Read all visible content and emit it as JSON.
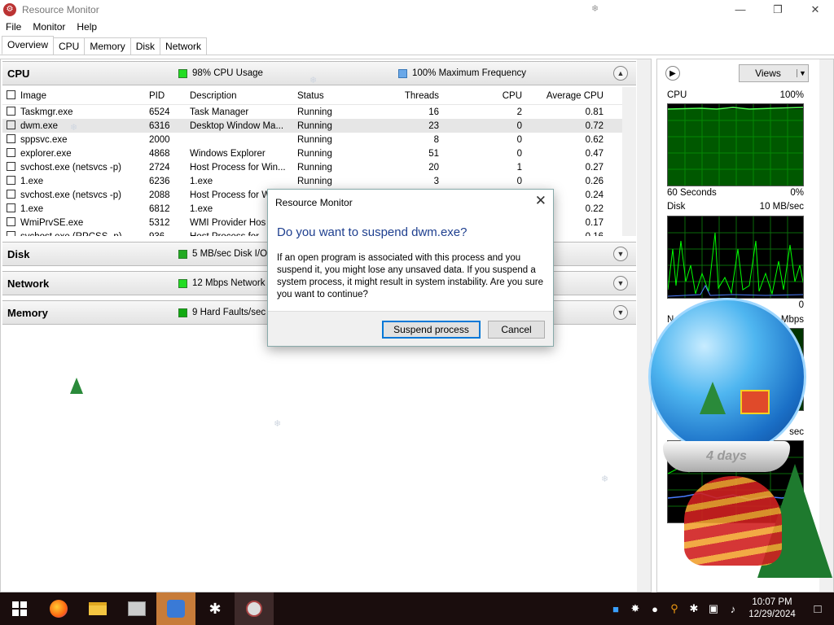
{
  "window": {
    "title": "Resource Monitor",
    "minimize_glyph": "—",
    "restore_glyph": "❐",
    "close_glyph": "✕"
  },
  "menu": [
    "File",
    "Monitor",
    "Help"
  ],
  "tabs": [
    "Overview",
    "CPU",
    "Memory",
    "Disk",
    "Network"
  ],
  "cpu_section": {
    "name": "CPU",
    "usage": "98% CPU Usage",
    "max_freq": "100% Maximum Frequency",
    "columns": [
      "Image",
      "PID",
      "Description",
      "Status",
      "Threads",
      "CPU",
      "Average CPU"
    ],
    "rows": [
      {
        "image": "Taskmgr.exe",
        "pid": "6524",
        "desc": "Task Manager",
        "status": "Running",
        "threads": "16",
        "cpu": "2",
        "avg": "0.81",
        "selected": false
      },
      {
        "image": "dwm.exe",
        "pid": "6316",
        "desc": "Desktop Window Ma...",
        "status": "Running",
        "threads": "23",
        "cpu": "0",
        "avg": "0.72",
        "selected": true
      },
      {
        "image": "sppsvc.exe",
        "pid": "2000",
        "desc": "",
        "status": "Running",
        "threads": "8",
        "cpu": "0",
        "avg": "0.62",
        "selected": false
      },
      {
        "image": "explorer.exe",
        "pid": "4868",
        "desc": "Windows Explorer",
        "status": "Running",
        "threads": "51",
        "cpu": "0",
        "avg": "0.47",
        "selected": false
      },
      {
        "image": "svchost.exe (netsvcs -p)",
        "pid": "2724",
        "desc": "Host Process for Win...",
        "status": "Running",
        "threads": "20",
        "cpu": "1",
        "avg": "0.27",
        "selected": false
      },
      {
        "image": "1.exe",
        "pid": "6236",
        "desc": "1.exe",
        "status": "Running",
        "threads": "3",
        "cpu": "0",
        "avg": "0.26",
        "selected": false
      },
      {
        "image": "svchost.exe (netsvcs -p)",
        "pid": "2088",
        "desc": "Host Process for W",
        "status": "",
        "threads": "",
        "cpu": "",
        "avg": "0.24",
        "selected": false
      },
      {
        "image": "1.exe",
        "pid": "6812",
        "desc": "1.exe",
        "status": "",
        "threads": "",
        "cpu": "",
        "avg": "0.22",
        "selected": false
      },
      {
        "image": "WmiPrvSE.exe",
        "pid": "5312",
        "desc": "WMI Provider Hos",
        "status": "",
        "threads": "",
        "cpu": "",
        "avg": "0.17",
        "selected": false
      },
      {
        "image": "svchost.exe (RPCSS -p)",
        "pid": "936",
        "desc": "Host Process for",
        "status": "",
        "threads": "",
        "cpu": "",
        "avg": "0.16",
        "selected": false
      }
    ]
  },
  "disk_section": {
    "name": "Disk",
    "stat": "5 MB/sec Disk I/O"
  },
  "network_section": {
    "name": "Network",
    "stat": "12 Mbps Network"
  },
  "memory_section": {
    "name": "Memory",
    "stat": "9 Hard Faults/sec"
  },
  "right_pane": {
    "views_label": "Views",
    "cpu_graph": {
      "label": "CPU",
      "max": "100%",
      "bottom_left": "60 Seconds",
      "bottom_right": "0%"
    },
    "disk_graph": {
      "label": "Disk",
      "max": "10 MB/sec",
      "bottom_right": "0"
    },
    "network_graph": {
      "label": "N",
      "max": "Mbps"
    },
    "memory_graph": {
      "max": "sec"
    }
  },
  "dialog": {
    "title": "Resource Monitor",
    "heading": "Do you want to suspend dwm.exe?",
    "body": "If an open program is associated with this process and you suspend it, you might lose any unsaved data. If you suspend a system process, it might result in system instability. Are you sure you want to continue?",
    "primary_button": "Suspend process",
    "cancel_button": "Cancel",
    "close_glyph": "✕"
  },
  "globe_text": "4 days",
  "taskbar": {
    "time": "10:07 PM",
    "date": "12/29/2024"
  },
  "colors": {
    "cpu_green": "#22dd22",
    "freq_blue": "#6aa8e8",
    "graph_green": "#00ff00"
  }
}
